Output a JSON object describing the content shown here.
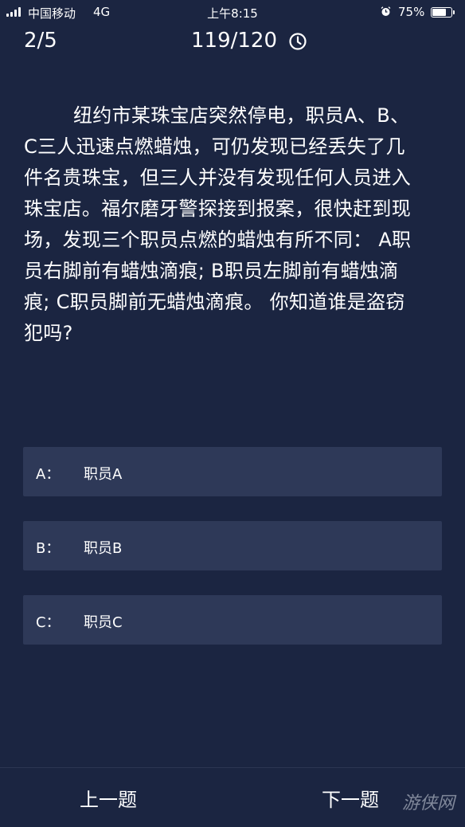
{
  "status_bar": {
    "carrier": "中国移动",
    "network": "4G",
    "time": "上午8:15",
    "battery": "75%",
    "battery_level": 0.75,
    "icons": [
      "signal-icon",
      "alarm-icon",
      "battery-icon"
    ]
  },
  "header": {
    "progress": "2/5",
    "timer": "119/120",
    "timer_icon": "clock-icon"
  },
  "question": {
    "text": "纽约市某珠宝店突然停电，职员A、B、C三人迅速点燃蜡烛，可仍发现已经丢失了几件名贵珠宝，但三人并没有发现任何人员进入珠宝店。福尔磨牙警探接到报案，很快赶到现场，发现三个职员点燃的蜡烛有所不同： A职员右脚前有蜡烛滴痕; B职员左脚前有蜡烛滴痕; C职员脚前无蜡烛滴痕。 你知道谁是盗窃犯吗?"
  },
  "options": [
    {
      "letter": "A：",
      "text": "职员A"
    },
    {
      "letter": "B：",
      "text": "职员B"
    },
    {
      "letter": "C：",
      "text": "职员C"
    }
  ],
  "nav": {
    "prev": "上一题",
    "next": "下一题"
  },
  "watermark": "游侠网",
  "colors": {
    "background": "#1b2541",
    "option_background": "#2e3958",
    "text": "#ffffff"
  }
}
